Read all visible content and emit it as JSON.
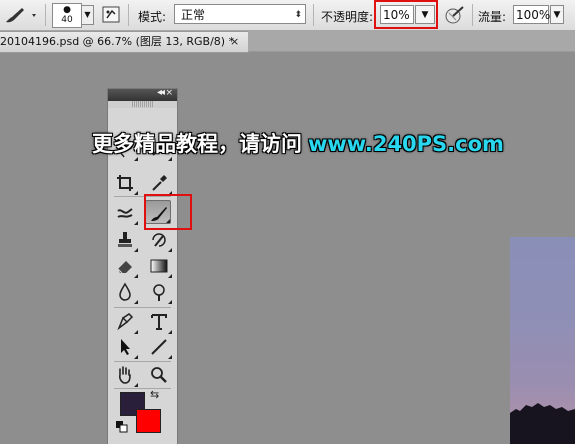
{
  "options_bar": {
    "brush_size": "40",
    "mode_label": "模式:",
    "mode_value": "正常",
    "opacity_label": "不透明度:",
    "opacity_value": "10%",
    "flow_label": "流量:",
    "flow_value": "100%"
  },
  "document_tab": {
    "title": "20104196.psd @ 66.7% (图层 13, RGB/8) *",
    "close": "×"
  },
  "tools_panel": {
    "collapse": "◂◂",
    "close": "×",
    "active_tool": "brush-tool",
    "foreground_color": "#2a1f3a",
    "background_color": "#ff0000",
    "highlight_color": "#e01010"
  },
  "watermark": {
    "text_cn": "更多精品教程，请访问",
    "url": "www.240PS.com"
  }
}
